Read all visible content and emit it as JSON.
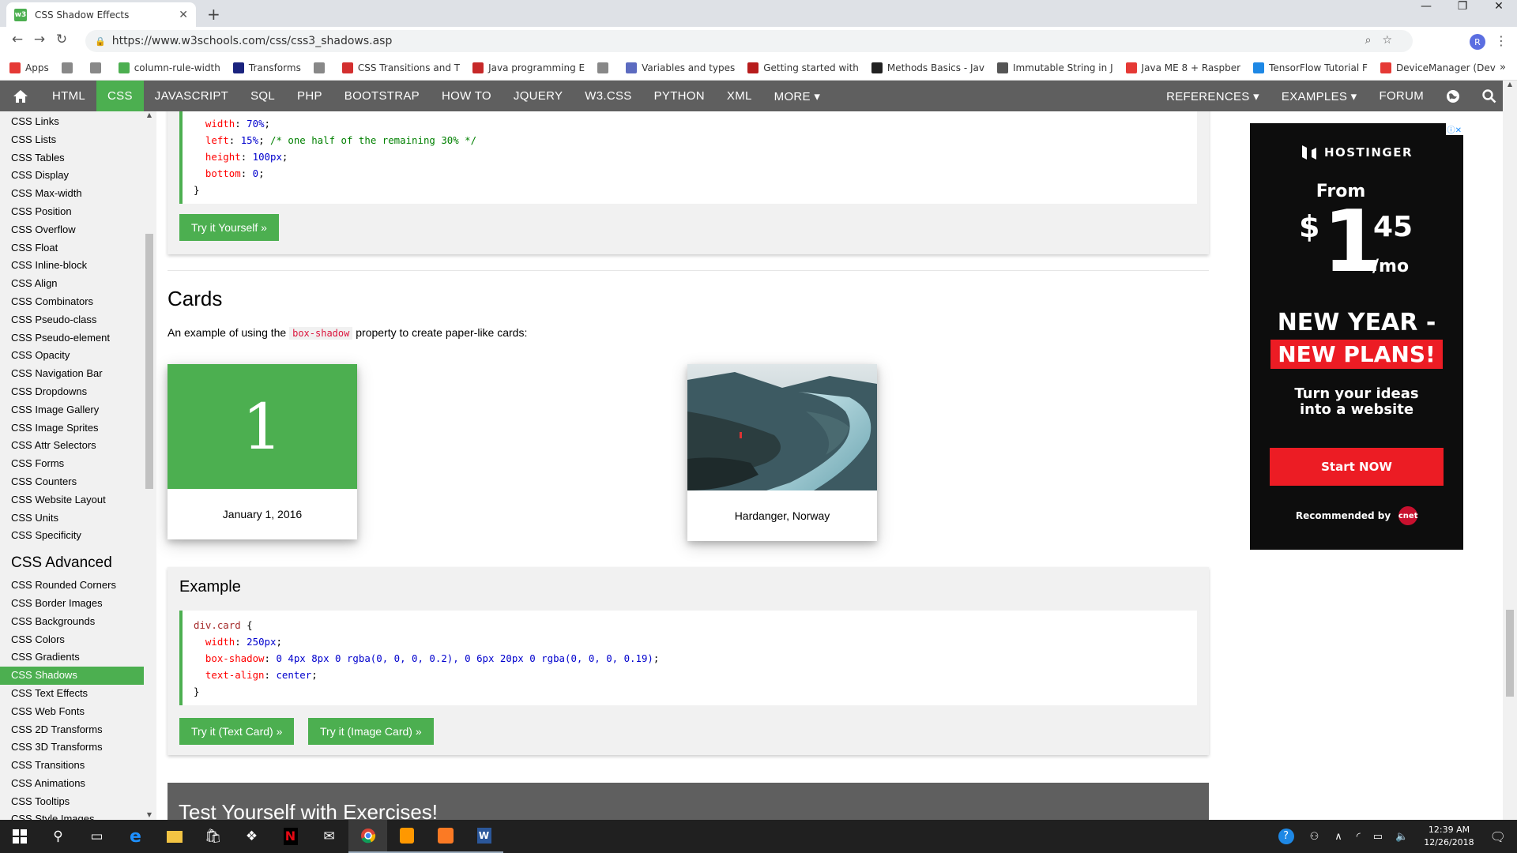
{
  "browser": {
    "tab_title": "CSS Shadow Effects",
    "tab_favicon": "w3",
    "url": "https://www.w3schools.com/css/css3_shadows.asp",
    "avatar_letter": "R",
    "bookmarks": [
      {
        "label": "Apps",
        "icon": "apps-grid-icon",
        "color": "#e53935"
      },
      {
        "label": "",
        "icon": "page-icon",
        "color": "#888"
      },
      {
        "label": "",
        "icon": "page-icon",
        "color": "#888"
      },
      {
        "label": "column-rule-width",
        "icon": "w3-icon",
        "color": "#4caf50"
      },
      {
        "label": "Transforms",
        "icon": "bird-icon",
        "color": "#1a237e"
      },
      {
        "label": "",
        "icon": "page-icon",
        "color": "#888"
      },
      {
        "label": "CSS Transitions and T",
        "icon": "ribbon-icon",
        "color": "#d32f2f"
      },
      {
        "label": "Java programming E",
        "icon": "java-icon",
        "color": "#c62828"
      },
      {
        "label": "",
        "icon": "page-icon",
        "color": "#888"
      },
      {
        "label": "Variables and types",
        "icon": "python-icon",
        "color": "#5c6bc0"
      },
      {
        "label": "Getting started with",
        "icon": "raspberry-icon",
        "color": "#b71c1c"
      },
      {
        "label": "Methods Basics - Jav",
        "icon": "sf-icon",
        "color": "#212121"
      },
      {
        "label": "Immutable String in J",
        "icon": "t-icon",
        "color": "#555"
      },
      {
        "label": "Java ME 8 + Raspber",
        "icon": "oracle-icon",
        "color": "#e53935"
      },
      {
        "label": "TensorFlow Tutorial F",
        "icon": "shield-icon",
        "color": "#1e88e5"
      },
      {
        "label": "DeviceManager (Dev",
        "icon": "oracle-icon",
        "color": "#e53935"
      }
    ],
    "bookmarks_more": "»"
  },
  "nav": {
    "left": [
      "HTML",
      "CSS",
      "JAVASCRIPT",
      "SQL",
      "PHP",
      "BOOTSTRAP",
      "HOW TO",
      "JQUERY",
      "W3.CSS",
      "PYTHON",
      "XML",
      "MORE ▾"
    ],
    "active": "CSS",
    "right": [
      "REFERENCES ▾",
      "EXAMPLES ▾",
      "FORUM"
    ]
  },
  "sidebar": {
    "items1": [
      "CSS Links",
      "CSS Lists",
      "CSS Tables",
      "CSS Display",
      "CSS Max-width",
      "CSS Position",
      "CSS Overflow",
      "CSS Float",
      "CSS Inline-block",
      "CSS Align",
      "CSS Combinators",
      "CSS Pseudo-class",
      "CSS Pseudo-element",
      "CSS Opacity",
      "CSS Navigation Bar",
      "CSS Dropdowns",
      "CSS Image Gallery",
      "CSS Image Sprites",
      "CSS Attr Selectors",
      "CSS Forms",
      "CSS Counters",
      "CSS Website Layout",
      "CSS Units",
      "CSS Specificity"
    ],
    "heading": "CSS Advanced",
    "items2": [
      "CSS Rounded Corners",
      "CSS Border Images",
      "CSS Backgrounds",
      "CSS Colors",
      "CSS Gradients",
      "CSS Shadows",
      "CSS Text Effects",
      "CSS Web Fonts",
      "CSS 2D Transforms",
      "CSS 3D Transforms",
      "CSS Transitions",
      "CSS Animations",
      "CSS Tooltips",
      "CSS Style Images"
    ],
    "active": "CSS Shadows"
  },
  "main": {
    "code1": {
      "l1_prop": "width",
      "l1_val": "70%",
      "l2_prop": "left",
      "l2_val": "15%",
      "l2_comment": "/* one half of the remaining 30% */",
      "l3_prop": "height",
      "l3_val": "100px",
      "l4_prop": "bottom",
      "l4_val": "0",
      "close": "}"
    },
    "try1": "Try it Yourself »",
    "cards_heading": "Cards",
    "intro_before": "An example of using the ",
    "intro_code": "box-shadow",
    "intro_after": " property to create paper-like cards:",
    "card1_number": "1",
    "card1_caption": "January 1, 2016",
    "card2_caption": "Hardanger, Norway",
    "example_heading": "Example",
    "code2": {
      "selector": "div.card",
      "l1_prop": "width",
      "l1_val": "250px",
      "l2_prop": "box-shadow",
      "l2_val": "0 4px 8px 0 rgba(0, 0, 0, 0.2), 0 6px 20px 0 rgba(0, 0, 0, 0.19)",
      "l3_prop": "text-align",
      "l3_val": "center",
      "close": "}"
    },
    "try_text_card": "Try it (Text Card) »",
    "try_image_card": "Try it (Image Card) »",
    "exercises_heading": "Test Yourself with Exercises!"
  },
  "ad": {
    "brand": "HOSTINGER",
    "from": "From",
    "currency": "$",
    "price_big": "1",
    "price_cents": "45",
    "per": "/mo",
    "headline1": "NEW YEAR -",
    "headline2": "NEW PLANS!",
    "tagline": "Turn your ideas into a website",
    "cta": "Start NOW",
    "recommended": "Recommended by",
    "rec_logo": "cnet"
  },
  "taskbar": {
    "time": "12:39 AM",
    "date": "12/26/2018"
  }
}
